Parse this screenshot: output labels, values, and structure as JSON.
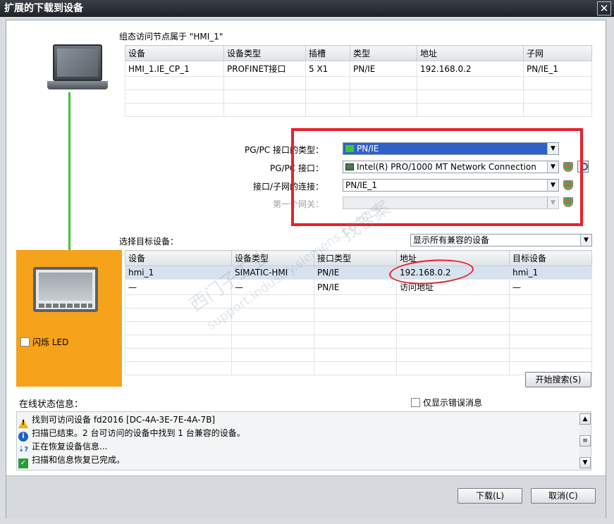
{
  "window": {
    "title": "扩展的下载到设备",
    "close_glyph": "✕"
  },
  "config_section": {
    "label": "组态访问节点属于 \"HMI_1\"",
    "columns": [
      "设备",
      "设备类型",
      "插槽",
      "类型",
      "地址",
      "子网"
    ],
    "rows": [
      [
        "HMI_1.IE_CP_1",
        "PROFINET接口",
        "5 X1",
        "PN/IE",
        "192.168.0.2",
        "PN/IE_1"
      ]
    ]
  },
  "interface": {
    "type_label": "PG/PC 接口的类型：",
    "type_value": "PN/IE",
    "iface_label": "PG/PC 接口：",
    "iface_value": "Intel(R) PRO/1000 MT Network Connection",
    "subnet_label": "接口/子网的连接：",
    "subnet_value": "PN/IE_1",
    "gateway_label": "第一个网关：",
    "gateway_value": ""
  },
  "target": {
    "label": "选择目标设备：",
    "filter_value": "显示所有兼容的设备",
    "columns": [
      "设备",
      "设备类型",
      "接口类型",
      "地址",
      "目标设备"
    ],
    "rows": [
      [
        "hmi_1",
        "SIMATIC-HMI",
        "PN/IE",
        "192.168.0.2",
        "hmi_1"
      ],
      [
        "—",
        "—",
        "PN/IE",
        "访问地址",
        "—"
      ]
    ]
  },
  "flash_led_label": "闪烁 LED",
  "search_button": "开始搜索(S)",
  "status": {
    "label": "在线状态信息：",
    "only_errors_label": "仅显示错误消息",
    "messages": [
      {
        "icon": "warning-icon",
        "text": "找到可访问设备 fd2016 [DC-4A-3E-7E-4A-7B]"
      },
      {
        "icon": "info-icon",
        "text": "扫描已结束。2 台可访问的设备中找到 1 台兼容的设备。"
      },
      {
        "icon": "retrieving-icon",
        "text": "正在恢复设备信息..."
      },
      {
        "icon": "check-icon",
        "text": "扫描和信息恢复已完成。"
      }
    ]
  },
  "buttons": {
    "download": "下载(L)",
    "cancel": "取消(C)"
  },
  "watermarks": [
    "西门子工业",
    "找答案",
    "support.industry.siemens.com/cs"
  ],
  "colors": {
    "highlight_box": "#e8202a",
    "orange_panel": "#f7a21b",
    "connection_line": "#3ec43a",
    "selection_blue": "#2f62c9"
  }
}
